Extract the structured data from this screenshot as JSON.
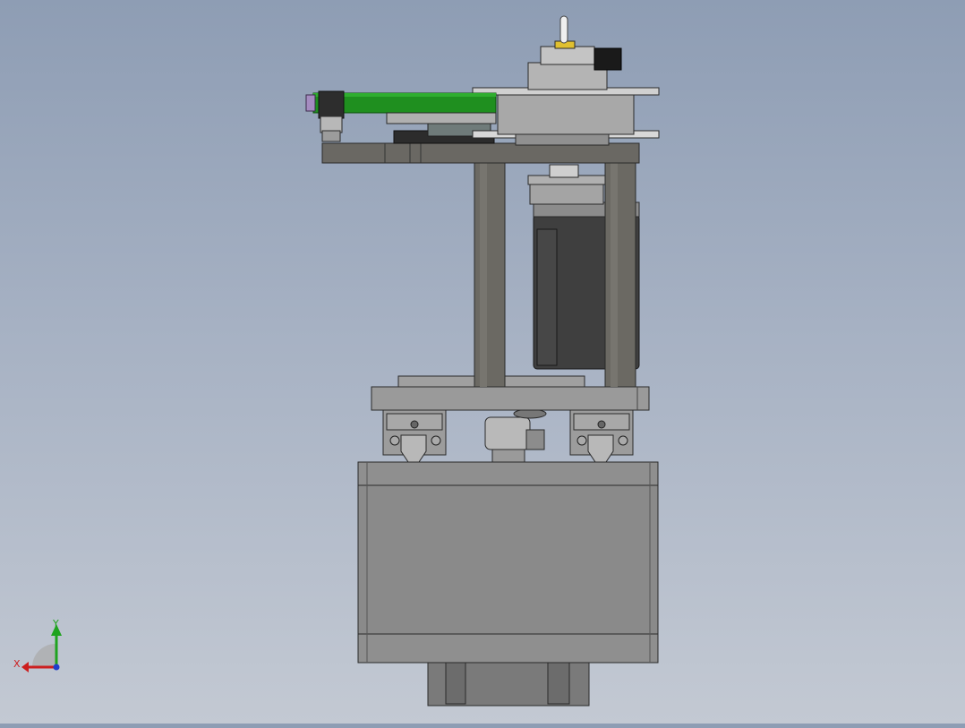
{
  "viewport": {
    "background_top": "#8e9db4",
    "background_bottom": "#c3c9d3"
  },
  "model": {
    "accent_green": "#1f8f1f",
    "metal_gray": "#8a8a8a",
    "dark_gray": "#5d5b57",
    "motor_black": "#3f3f3f"
  },
  "triad": {
    "x_label": "X",
    "y_label": "Y",
    "x_color": "#cc1f1f",
    "y_color": "#1fa31f",
    "z_color": "#1f3fcc"
  }
}
